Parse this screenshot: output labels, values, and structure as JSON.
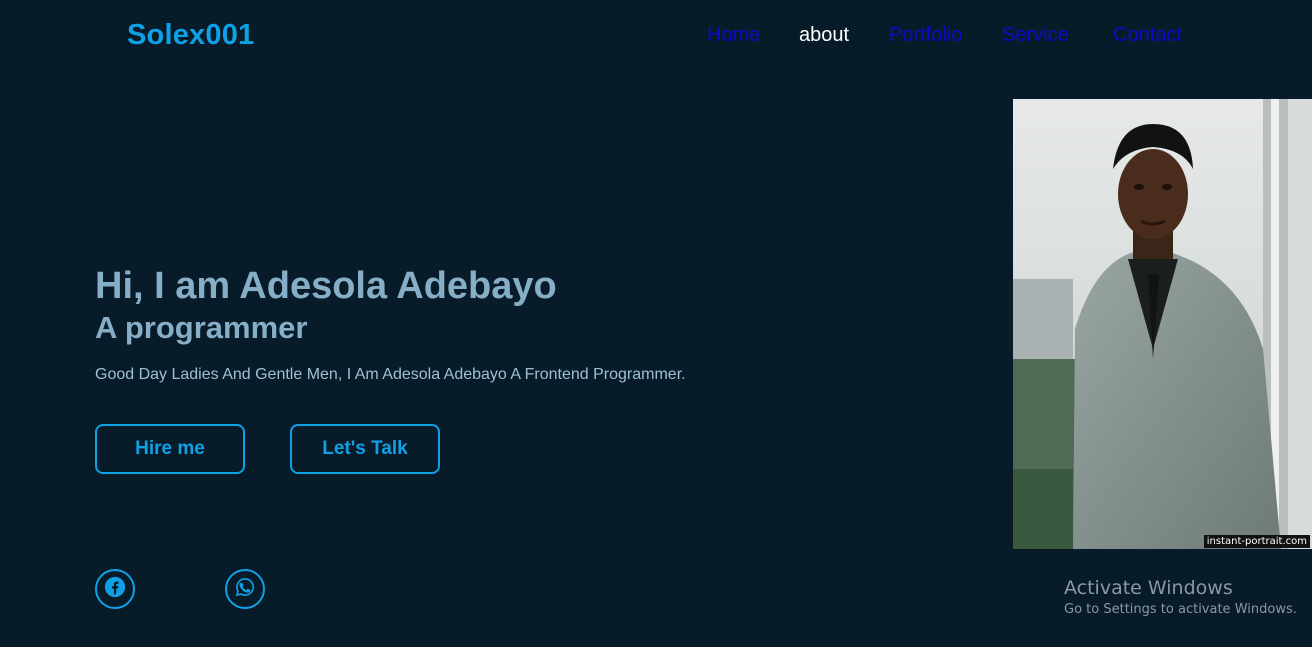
{
  "header": {
    "logo": "Solex001",
    "nav": [
      {
        "label": "Home",
        "active": false
      },
      {
        "label": "about",
        "active": true
      },
      {
        "label": "Portfolio",
        "active": false
      },
      {
        "label": "Service",
        "active": false
      },
      {
        "label": "Contact",
        "active": false
      }
    ]
  },
  "hero": {
    "title": "Hi, I am Adesola Adebayo",
    "subtitle": "A programmer",
    "description": "Good Day Ladies And Gentle Men, I Am Adesola Adebayo A Frontend Programmer.",
    "buttons": {
      "hire": "Hire me",
      "talk": "Let's Talk"
    }
  },
  "social": [
    {
      "icon": "facebook-icon"
    },
    {
      "icon": "whatsapp-icon"
    }
  ],
  "portrait": {
    "watermark": "instant-portrait.com"
  },
  "windows_overlay": {
    "title": "Activate Windows",
    "subtitle": "Go to Settings to activate Windows."
  },
  "colors": {
    "background": "#081b29",
    "accent": "#0ea1e6",
    "nav_link": "#0b0bc9",
    "heading": "#86aec6"
  }
}
